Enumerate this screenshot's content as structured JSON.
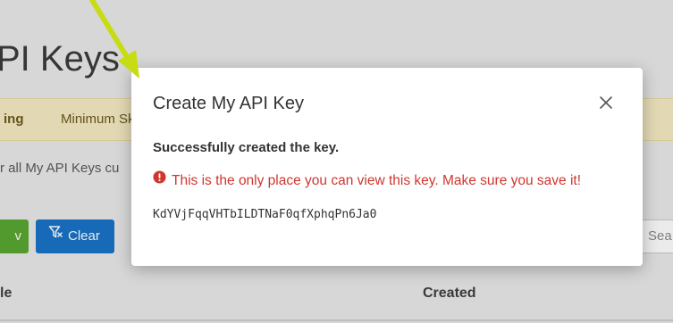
{
  "page": {
    "title": "PI Keys",
    "warning": {
      "strong": "ing",
      "text": "Minimum Sky"
    },
    "description": "r all My API Keys cu",
    "toolbar": {
      "green_button_label": "v",
      "clear_button_label": "Clear",
      "search_placeholder": "Sea"
    },
    "table": {
      "columns": [
        "le",
        "Created"
      ]
    }
  },
  "modal": {
    "title": "Create My API Key",
    "close_icon": "close-icon",
    "success_message": "Successfully created the key.",
    "warning_icon": "exclamation-circle-icon",
    "warning_message": "This is the only place you can view this key. Make sure you save it!",
    "api_key": "KdYVjFqqVHTbILDTNaF0qfXphqPn6Ja0"
  },
  "colors": {
    "annotation_arrow": "#c8dc14",
    "clear_button": "#1a73c7",
    "green_button": "#5aa832",
    "warning_bar": "#f6ecc4",
    "alert_text": "#d0362f"
  }
}
